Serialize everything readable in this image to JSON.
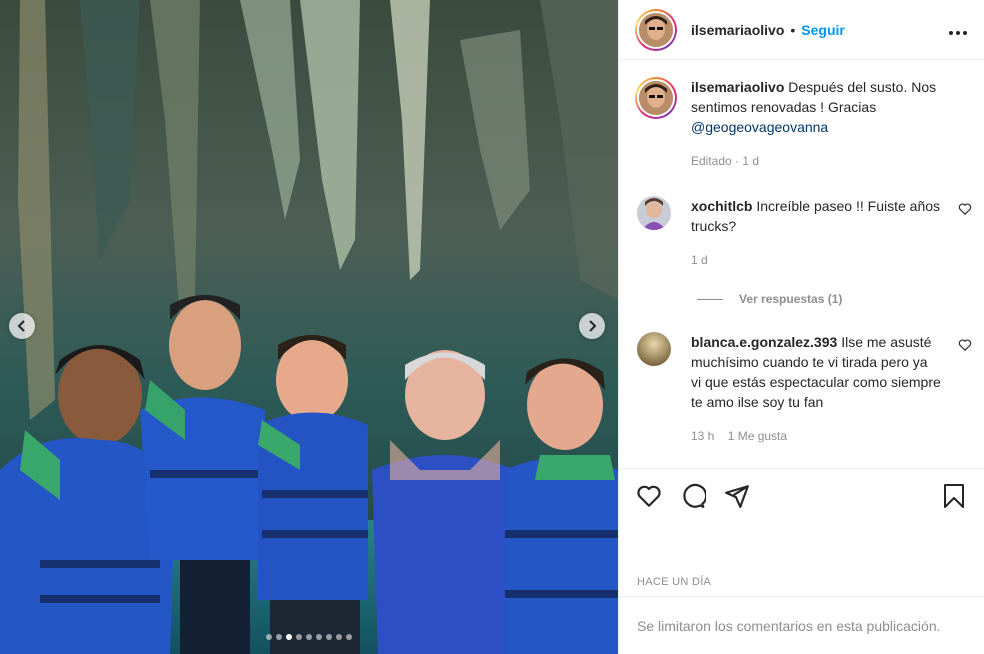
{
  "post": {
    "username": "ilsemariaolivo",
    "separator": "•",
    "follow_label": "Seguir",
    "more_icon": "ellipsis-icon",
    "caption_text": "Después del susto. Nos sentimos renovadas ! Gracias",
    "caption_mention": "@geogeovageovanna",
    "caption_meta": "Editado · 1 d"
  },
  "comments": [
    {
      "username": "xochitlcb",
      "text": "Increíble paseo !! Fuiste años trucks?",
      "time": "1 d",
      "replies_label": "Ver respuestas (1)"
    },
    {
      "username": "blanca.e.gonzalez.393",
      "text": "Ilse me asusté muchísimo cuando te vi tirada pero ya vi que estás espectacular como siempre te amo ilse soy tu fan",
      "meta": "13 h    1 Me gusta"
    }
  ],
  "actions": {
    "like_icon": "heart-icon",
    "comment_icon": "comment-icon",
    "share_icon": "send-icon",
    "save_icon": "bookmark-icon"
  },
  "time_ago": "HACE UN DÍA",
  "comments_limited": "Se limitaron los comentarios en esta publicación.",
  "carousel": {
    "slide_count": 9,
    "active_index": 2
  },
  "colors": {
    "link_blue": "#0095f6",
    "mention_blue": "#00376b",
    "muted": "#8e8e8e",
    "text": "#262626",
    "border": "#efefef"
  }
}
